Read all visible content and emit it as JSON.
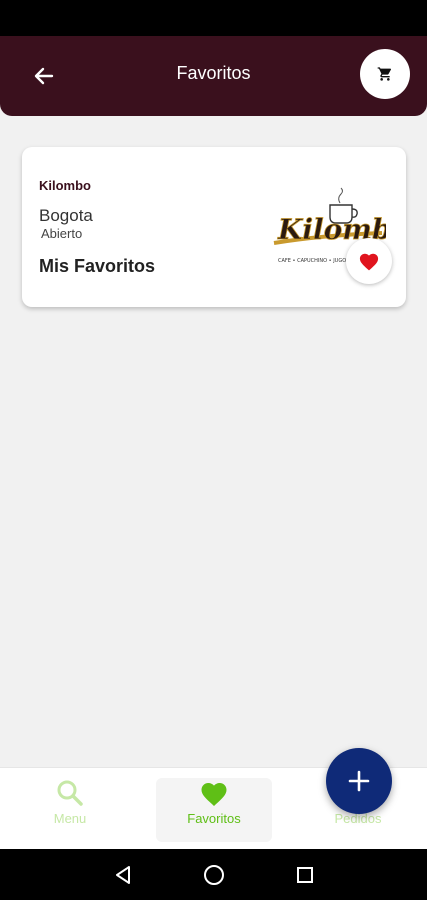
{
  "header": {
    "title": "Favoritos",
    "back_icon": "arrow-left-icon",
    "cart_icon": "cart-icon"
  },
  "store": {
    "name": "Kilombo",
    "city": "Bogota",
    "status": "Abierto",
    "section": "Mis Favoritos",
    "logo_text": "Kilombo",
    "logo_tagline": "CAFE • CAPUCHINO • JUGO",
    "favorite_icon": "heart-icon"
  },
  "bottom_nav": {
    "items": [
      {
        "label": "Menu",
        "icon": "search-icon"
      },
      {
        "label": "Favoritos",
        "icon": "heart-icon"
      },
      {
        "label": "Pedidos",
        "icon": "orders-icon"
      }
    ],
    "active": "Favoritos"
  },
  "fab": {
    "icon": "plus-icon"
  },
  "colors": {
    "app_bar": "#3a101d",
    "heart": "#e0141e",
    "nav_active": "#5fbf16",
    "nav_inactive": "#c6e8a6",
    "fab": "#0f2a78",
    "background": "#f1f1f1"
  }
}
